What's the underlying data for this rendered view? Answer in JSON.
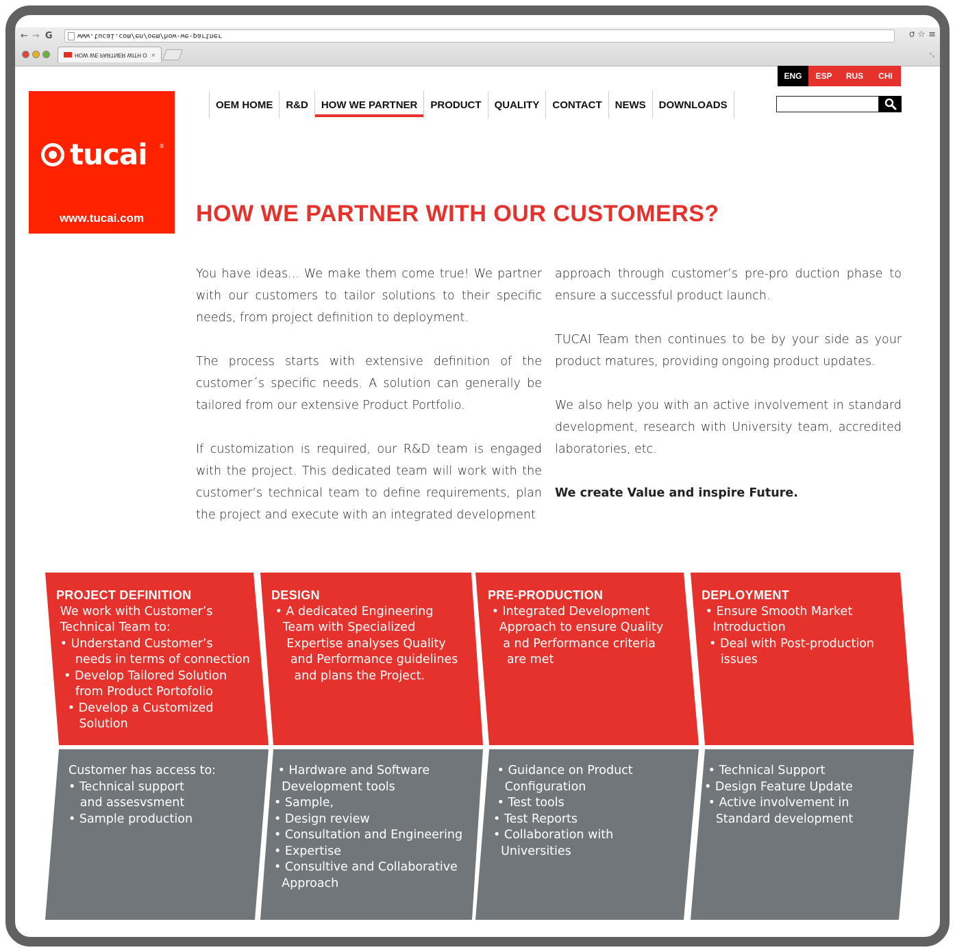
{
  "browser": {
    "url": "www.tucai.com/en/oem/how-we-partner",
    "tab_title": "HOW WE PARTNER WITH O",
    "tab_close": "×"
  },
  "languages": [
    {
      "label": "ENG",
      "active": true
    },
    {
      "label": "ESP",
      "active": false
    },
    {
      "label": "RUS",
      "active": false
    },
    {
      "label": "CHI",
      "active": false
    }
  ],
  "logo": {
    "word": "tucai",
    "reg": "®",
    "url": "www.tucai.com"
  },
  "nav": [
    {
      "label": "OEM HOME",
      "active": false
    },
    {
      "label": "R&D",
      "active": false
    },
    {
      "label": "HOW WE PARTNER",
      "active": true
    },
    {
      "label": "PRODUCT",
      "active": false
    },
    {
      "label": "QUALITY",
      "active": false
    },
    {
      "label": "CONTACT",
      "active": false
    },
    {
      "label": "NEWS",
      "active": false
    },
    {
      "label": "DOWNLOADS",
      "active": false
    }
  ],
  "search": {
    "placeholder": "",
    "icon": "search-icon"
  },
  "heading": "HOW WE PARTNER WITH OUR CUSTOMERS?",
  "column1": {
    "p1": "You have ideas... We make them come true! We partner with our customers to tailor solutions to their specific needs, from project definition to deployment.",
    "p2": "The process starts with extensive definition of the customer´s specific needs. A solution can generally be tailored from our extensive Product Portfolio.",
    "p3": "If customization is required, our R&D team is engaged with the project. This dedicated team will work with the customer’s technical team to define requirements, plan the project and execute with an integrated development"
  },
  "column2": {
    "p1": "approach through customer’s pre-pro duction phase to ensure a successful product launch.",
    "p2": "TUCAI Team then continues to be by your side as your product matures, providing ongoing product updates.",
    "p3": "We also help you with an active involvement in standard development, research with University team, accredited laboratories, etc.",
    "p4": "We create Value and inspire Future."
  },
  "stages": [
    {
      "title": "PROJECT DEFINITION",
      "top": " We work with Customer’s\n Technical Team to:\n • Understand Customer’s\n     needs in terms of connection\n  • Develop Tailored Solution\n     from Product Portofolio\n   • Develop a Customized\n      Solution",
      "bottom": "Customer has access to:\n• Technical support\n   and assesvsment\n• Sample production"
    },
    {
      "title": "DESIGN",
      "top": " • A dedicated Engineering\n   Team with Specialized\n    Expertise analyses Quality\n     and Performance guidelines\n      and plans the Project.",
      "bottom": " • Hardware and Software\n  Development tools\n• Sample,\n• Design review\n• Consultation and Engineering\n• Expertise\n• Consultive and Collaborative\n  Approach"
    },
    {
      "title": "PRE-PRODUCTION",
      "top": " • Integrated Development\n   Approach to ensure Quality\n    a nd Performance criteria\n     are met",
      "bottom": " • Guidance on Product\n   Configuration\n • Test tools\n• Test Reports\n• Collaboration with\n  Universities"
    },
    {
      "title": "DEPLOYMENT",
      "top": " • Ensure Smooth Market\n   Introduction\n  • Deal with Post-production\n     issues",
      "bottom": " • Technical Support\n• Design Feature Update\n • Active involvement in\n   Standard development"
    }
  ],
  "colors": {
    "red": "#e5322d",
    "logo_red": "#ff2200",
    "grey": "#71767b",
    "black": "#000000"
  }
}
